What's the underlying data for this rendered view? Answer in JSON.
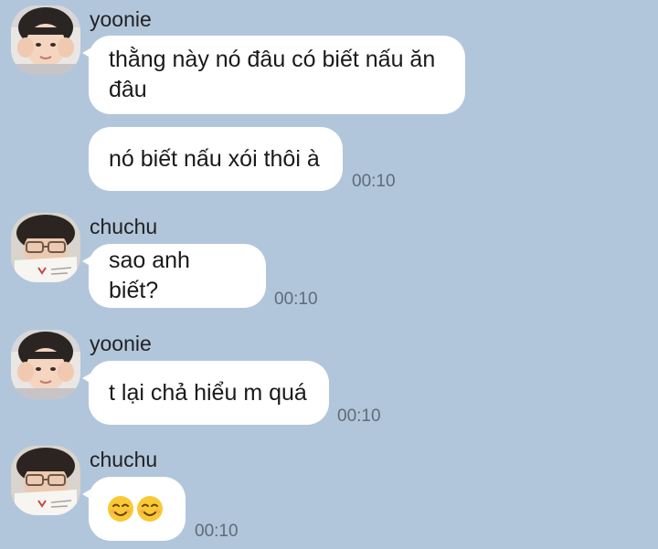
{
  "messages": [
    {
      "sender": "yoonie",
      "bubbles": [
        "thằng này nó đâu có biết nấu ăn đâu",
        "nó biết nấu xói thôi à"
      ],
      "time": "00:10"
    },
    {
      "sender": "chuchu",
      "bubbles": [
        "sao anh biết?"
      ],
      "time": "00:10"
    },
    {
      "sender": "yoonie",
      "bubbles": [
        "t lại chả hiểu m quá"
      ],
      "time": "00:10"
    },
    {
      "sender": "chuchu",
      "bubbles": [],
      "emoji": [
        "smiling-face-emoji",
        "smiling-face-emoji"
      ],
      "time": "00:10"
    }
  ],
  "colors": {
    "background": "#b2c6db",
    "bubble": "#ffffff",
    "timestamp": "#5e6c79",
    "sender_name": "#222222"
  }
}
